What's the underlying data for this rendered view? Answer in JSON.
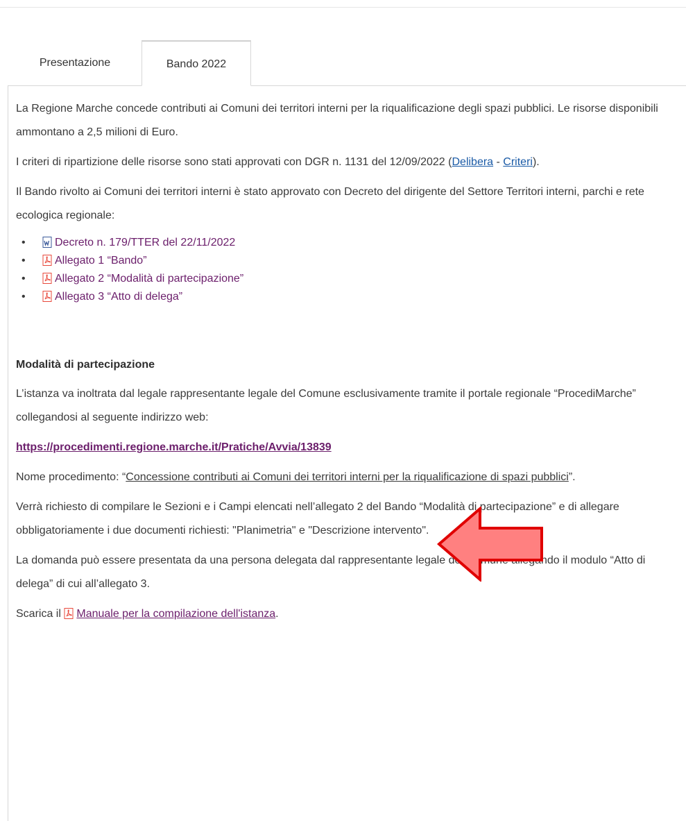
{
  "tabs": [
    {
      "label": "Presentazione",
      "active": false
    },
    {
      "label": "Bando 2022",
      "active": true
    }
  ],
  "content": {
    "para1": "La Regione Marche concede contributi ai Comuni dei territori interni per la riqualificazione degli spazi pubblici. Le risorse disponibili ammontano a 2,5 milioni di Euro.",
    "para2_prefix": "I criteri di ripartizione delle risorse sono stati approvati con DGR n. 1131 del 12/09/2022 (",
    "para2_link1": "Delibera",
    "para2_sep": " - ",
    "para2_link2": "Criteri",
    "para2_suffix": ").",
    "para3": "Il Bando rivolto ai Comuni dei territori interni è stato approvato con Decreto del dirigente del Settore Territori interni, parchi e rete ecologica regionale:",
    "documents": [
      {
        "icon": "word-doc-icon",
        "label": "Decreto n. 179/TTER del 22/11/2022"
      },
      {
        "icon": "pdf-icon",
        "label": "Allegato 1 “Bando”"
      },
      {
        "icon": "pdf-icon",
        "label": "Allegato 2 “Modalità di partecipazione”"
      },
      {
        "icon": "pdf-icon",
        "label": "Allegato 3 “Atto di delega”"
      }
    ],
    "section_title": "Modalità di partecipazione",
    "para4": "L’istanza va inoltrata dal legale rappresentante legale del Comune esclusivamente tramite il portale regionale “ProcediMarche” collegandosi al seguente indirizzo web:",
    "url": "https://procedimenti.regione.marche.it/Pratiche/Avvia/13839",
    "para5_prefix": "Nome procedimento: “",
    "para5_link": "Concessione contributi ai Comuni dei territori interni per la riqualificazione di spazi pubblici",
    "para5_suffix": "”.",
    "para6": "Verrà richiesto di compilare le Sezioni e i Campi elencati nell’allegato 2 del Bando “Modalità di partecipazione” e di allegare obbligatoriamente i due documenti richiesti: \"Planimetria\" e \"Descrizione intervento\".",
    "para7": "La domanda può essere presentata da una persona delegata dal rappresentante legale del Comune allegando il modulo “Atto di delega” di cui all’allegato 3.",
    "para8_prefix": "Scarica il ",
    "para8_link": "Manuale per la compilazione dell'istanza",
    "para8_suffix": "."
  },
  "colors": {
    "text": "#3a3a3a",
    "link_visited": "#6b1e6b",
    "link": "#1a5aa6",
    "pdf_icon": "#e8483b",
    "arrow_fill": "#ff8080",
    "arrow_stroke": "#e00000"
  }
}
